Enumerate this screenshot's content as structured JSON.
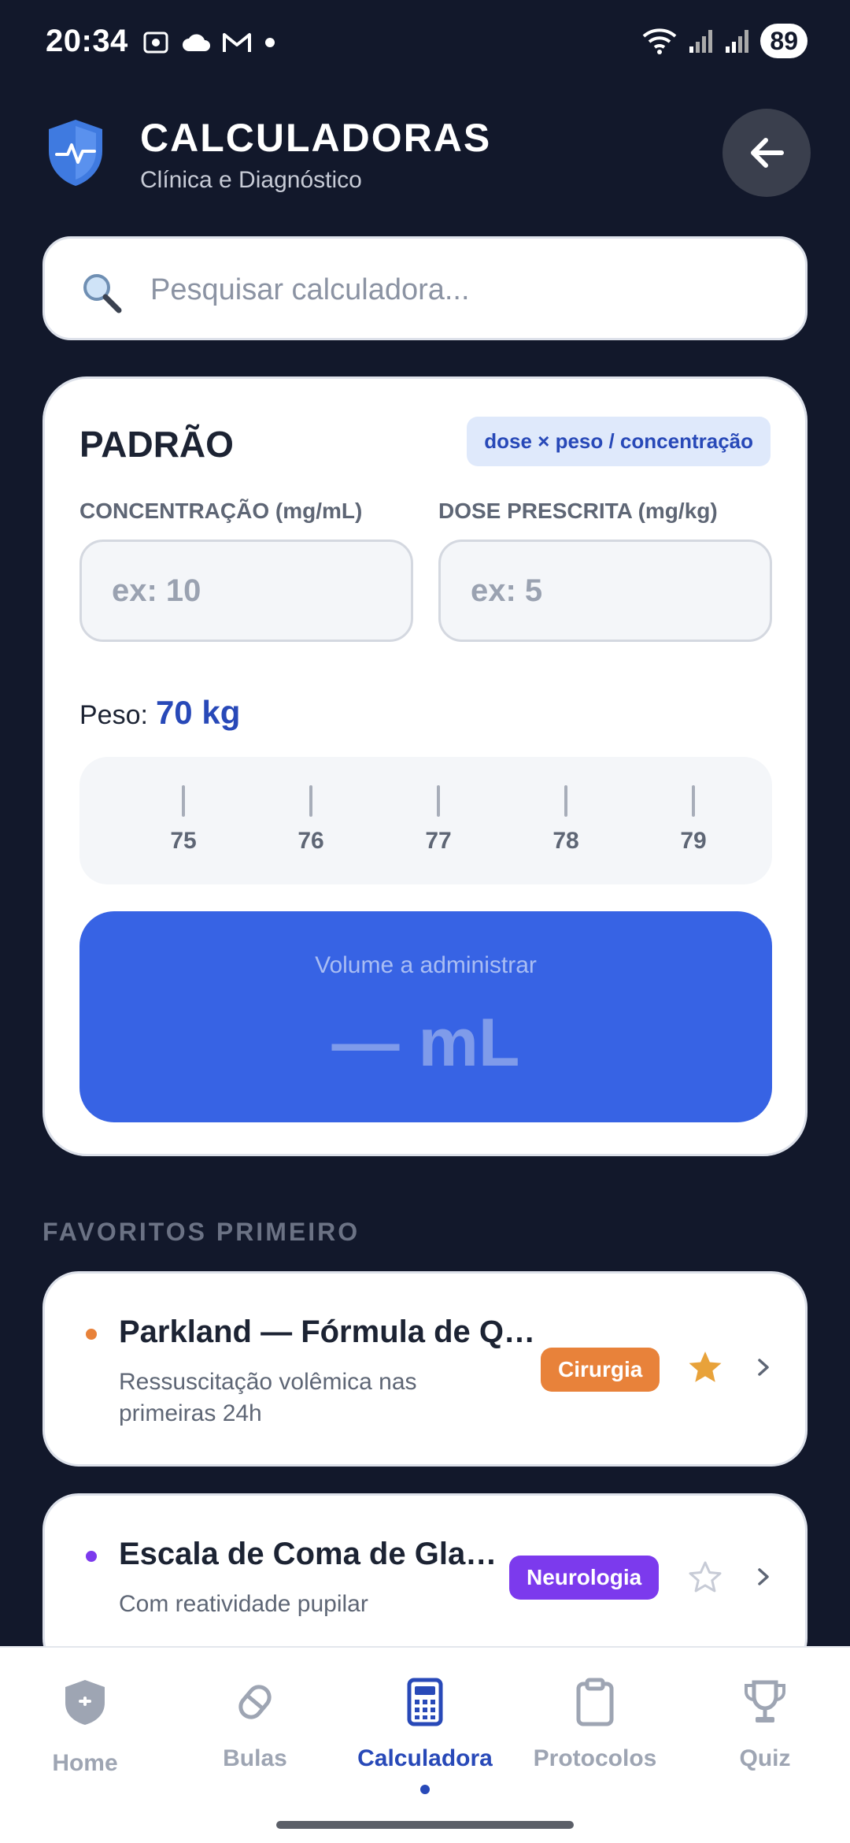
{
  "status_bar": {
    "time": "20:34",
    "battery": "89"
  },
  "header": {
    "title": "CALCULADORAS",
    "subtitle": "Clínica e Diagnóstico"
  },
  "search": {
    "placeholder": "Pesquisar calculadora..."
  },
  "calculator": {
    "title": "PADRÃO",
    "formula": "dose × peso / concentração",
    "concentration_label": "CONCENTRAÇÃO (mg/mL)",
    "concentration_placeholder": "ex: 10",
    "dose_label": "DOSE PRESCRITA (mg/kg)",
    "dose_placeholder": "ex: 5",
    "weight_label": "Peso:",
    "weight_value": "70 kg",
    "ruler_ticks": [
      "75",
      "76",
      "77",
      "78",
      "79"
    ],
    "result_label": "Volume a administrar",
    "result_value": "— mL"
  },
  "favorites": {
    "section_title": "FAVORITOS PRIMEIRO",
    "items": [
      {
        "title": "Parkland — Fórmula de Queimados",
        "description": "Ressuscitação volêmica nas primeiras 24h",
        "tag": "Cirurgia",
        "tag_color": "#e8823a",
        "favorited": true
      },
      {
        "title": "Escala de Coma de Glasgow",
        "description": "Com reatividade pupilar",
        "tag": "Neurologia",
        "tag_color": "#7c3aed",
        "favorited": false
      }
    ]
  },
  "nav": {
    "items": [
      {
        "label": "Home",
        "icon": "shield-icon"
      },
      {
        "label": "Bulas",
        "icon": "pill-icon"
      },
      {
        "label": "Calculadora",
        "icon": "calculator-icon",
        "active": true
      },
      {
        "label": "Protocolos",
        "icon": "clipboard-icon"
      },
      {
        "label": "Quiz",
        "icon": "trophy-icon"
      }
    ]
  },
  "colors": {
    "background": "#12182b",
    "accent": "#2849b8",
    "result_bg": "#3763e4",
    "star_active": "#e8a23a"
  }
}
